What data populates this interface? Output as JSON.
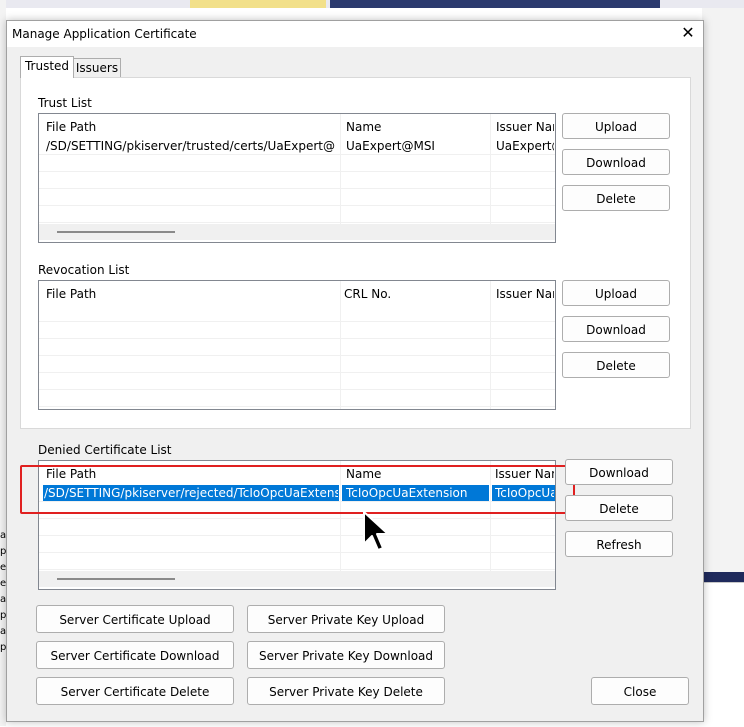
{
  "dialog": {
    "title": "Manage Application Certificate",
    "close_glyph": "✕"
  },
  "tabs": [
    {
      "label": "Trusted",
      "active": true
    },
    {
      "label": "Issuers",
      "active": false
    }
  ],
  "trust_list": {
    "label": "Trust List",
    "columns": [
      "File Path",
      "Name",
      "Issuer Nam"
    ],
    "rows": [
      [
        "/SD/SETTING/pkiserver/trusted/certs/UaExpert@MSI ...",
        "UaExpert@MSI",
        "UaExpert@MSI"
      ]
    ],
    "buttons": [
      "Upload",
      "Download",
      "Delete"
    ]
  },
  "revocation_list": {
    "label": "Revocation List",
    "columns": [
      "File Path",
      "CRL No.",
      "Issuer Nam"
    ],
    "rows": [],
    "buttons": [
      "Upload",
      "Download",
      "Delete"
    ]
  },
  "denied_list": {
    "label": "Denied Certificate List",
    "columns": [
      "File Path",
      "Name",
      "Issuer Nam"
    ],
    "rows": [
      [
        "/SD/SETTING/pkiserver/rejected/TcIoOpcUaExtension...",
        "TcIoOpcUaExtension",
        "TcIoOpcUaExtension"
      ]
    ],
    "buttons": [
      "Download",
      "Delete",
      "Refresh"
    ]
  },
  "bottom_buttons": {
    "server_cert_upload": "Server Certificate Upload",
    "server_key_upload": "Server Private Key Upload",
    "server_cert_download": "Server Certificate Download",
    "server_key_download": "Server Private Key Download",
    "server_cert_delete": "Server Certificate Delete",
    "server_key_delete": "Server Private Key Delete",
    "close": "Close"
  },
  "background_left_fragments": [
    "a",
    "p",
    "e",
    "e",
    "a",
    "p",
    "a",
    "p"
  ],
  "colors": {
    "selection": "#0078d7",
    "highlight_box": "#e02020"
  }
}
